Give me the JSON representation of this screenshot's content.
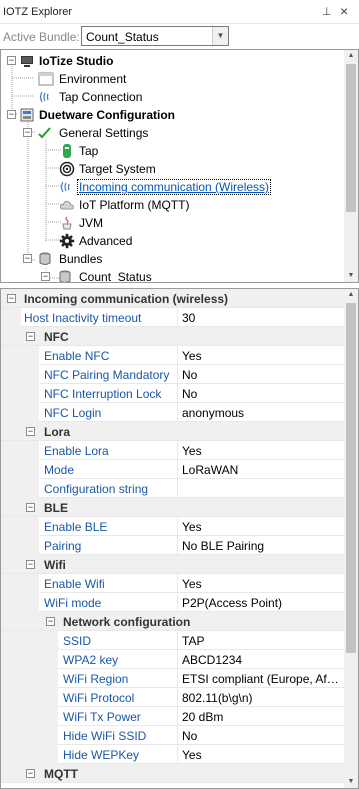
{
  "window": {
    "title": "IOTZ Explorer",
    "pin_glyph": "⊥",
    "close_glyph": "×"
  },
  "bundle": {
    "label": "Active Bundle:",
    "value": "Count_Status"
  },
  "tree": {
    "items": [
      {
        "label": "IoTize Studio",
        "bold": true,
        "icon": "computer-icon"
      },
      {
        "label": "Environment",
        "icon": "window-icon"
      },
      {
        "label": "Tap Connection",
        "icon": "wireless-icon"
      },
      {
        "label": "Duetware Configuration",
        "bold": true,
        "icon": "config-icon"
      },
      {
        "label": "General Settings",
        "icon": "settings-check-icon"
      },
      {
        "label": "Tap",
        "icon": "tap-device-icon"
      },
      {
        "label": "Target System",
        "icon": "target-icon"
      },
      {
        "label": "Incoming communication (Wireless)",
        "icon": "wireless-icon",
        "selected": true
      },
      {
        "label": "IoT Platform (MQTT)",
        "icon": "cloud-icon"
      },
      {
        "label": "JVM",
        "icon": "java-icon"
      },
      {
        "label": "Advanced",
        "icon": "gear-icon"
      },
      {
        "label": "Bundles",
        "icon": "bundles-icon"
      },
      {
        "label": "Count_Status",
        "icon": "bundle-icon"
      }
    ]
  },
  "props": {
    "header": "Incoming communication (wireless)",
    "host": {
      "name": "Host Inactivity timeout",
      "value": "30"
    },
    "nfc": {
      "title": "NFC",
      "rows": [
        {
          "name": "Enable NFC",
          "value": "Yes"
        },
        {
          "name": "NFC Pairing Mandatory",
          "value": "No"
        },
        {
          "name": "NFC Interruption Lock",
          "value": "No"
        },
        {
          "name": "NFC Login",
          "value": "anonymous"
        }
      ]
    },
    "lora": {
      "title": "Lora",
      "rows": [
        {
          "name": "Enable Lora",
          "value": "Yes"
        },
        {
          "name": "Mode",
          "value": "LoRaWAN"
        },
        {
          "name": "Configuration string",
          "value": ""
        }
      ]
    },
    "ble": {
      "title": "BLE",
      "rows": [
        {
          "name": "Enable BLE",
          "value": "Yes"
        },
        {
          "name": "Pairing",
          "value": "No BLE Pairing"
        }
      ]
    },
    "wifi": {
      "title": "Wifi",
      "rows": [
        {
          "name": "Enable Wifi",
          "value": "Yes"
        },
        {
          "name": "WiFi mode",
          "value": "P2P(Access Point)"
        }
      ],
      "network": {
        "title": "Network configuration",
        "rows": [
          {
            "name": "SSID",
            "value": "TAP"
          },
          {
            "name": "WPA2 key",
            "value": "ABCD1234"
          },
          {
            "name": "WiFi Region",
            "value": "ETSI compliant (Europe, Af…"
          },
          {
            "name": "WiFi Protocol",
            "value": "802.11(b\\g\\n)"
          },
          {
            "name": "WiFi Tx Power",
            "value": "20 dBm"
          },
          {
            "name": "Hide WiFi SSID",
            "value": "No"
          },
          {
            "name": "Hide WEPKey",
            "value": "Yes"
          }
        ]
      }
    },
    "mqtt": {
      "title": "MQTT"
    }
  },
  "colors": {
    "link": "#1a57a8",
    "selected_text": "#0057b8",
    "gutter": "#f0f0f0"
  }
}
